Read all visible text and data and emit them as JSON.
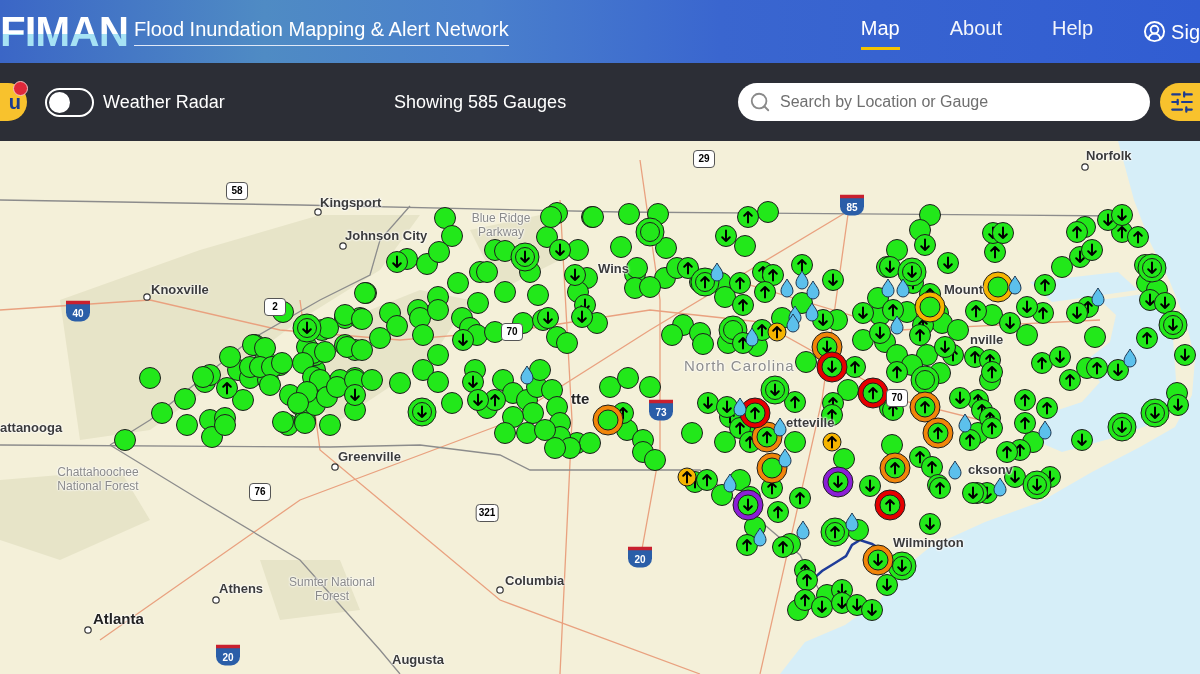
{
  "header": {
    "logo": "FIMAN",
    "subtitle": "Flood Inundation Mapping & Alert Network",
    "nav": [
      {
        "label": "Map",
        "selected": true
      },
      {
        "label": "About",
        "selected": false
      },
      {
        "label": "Help",
        "selected": false
      }
    ],
    "account": "Sig"
  },
  "toolbar": {
    "menu_button": {
      "label": "u",
      "notification": true
    },
    "radar_toggle": {
      "label": "Weather Radar",
      "on": false
    },
    "gauge_count": "Showing 585 Gauges",
    "search": {
      "placeholder": "Search by Location or Gauge"
    }
  },
  "map": {
    "places": [
      {
        "name": "Norfolk",
        "kind": "city"
      },
      {
        "name": "Kingsport",
        "kind": "city"
      },
      {
        "name": "Johnson City",
        "kind": "city"
      },
      {
        "name": "Blue Ridge Parkway",
        "kind": "region"
      },
      {
        "name": "Knoxville",
        "kind": "city"
      },
      {
        "name": "Wins",
        "kind": "city"
      },
      {
        "name": "Mount",
        "kind": "city"
      },
      {
        "name": "North Carolina",
        "kind": "state"
      },
      {
        "name": "nville",
        "kind": "city"
      },
      {
        "name": "tte",
        "kind": "major_city"
      },
      {
        "name": "attanooga",
        "kind": "city"
      },
      {
        "name": "etteville",
        "kind": "city"
      },
      {
        "name": "Chattahoochee National Forest",
        "kind": "region"
      },
      {
        "name": "Greenville",
        "kind": "city"
      },
      {
        "name": "cksonv",
        "kind": "city"
      },
      {
        "name": "Wilmington",
        "kind": "city"
      },
      {
        "name": "Sumter National Forest",
        "kind": "region"
      },
      {
        "name": "Columbia",
        "kind": "city"
      },
      {
        "name": "Athens",
        "kind": "city"
      },
      {
        "name": "Atlanta",
        "kind": "major_city"
      },
      {
        "name": "Augusta",
        "kind": "city"
      }
    ],
    "route_shields": [
      {
        "label": "29",
        "kind": "us"
      },
      {
        "label": "58",
        "kind": "us"
      },
      {
        "label": "85",
        "kind": "interstate"
      },
      {
        "label": "2",
        "kind": "us"
      },
      {
        "label": "40",
        "kind": "interstate"
      },
      {
        "label": "70",
        "kind": "us"
      },
      {
        "label": "70",
        "kind": "us"
      },
      {
        "label": "73",
        "kind": "interstate"
      },
      {
        "label": "76",
        "kind": "us"
      },
      {
        "label": "321",
        "kind": "us"
      },
      {
        "label": "20",
        "kind": "interstate"
      },
      {
        "label": "20",
        "kind": "interstate"
      }
    ]
  }
}
